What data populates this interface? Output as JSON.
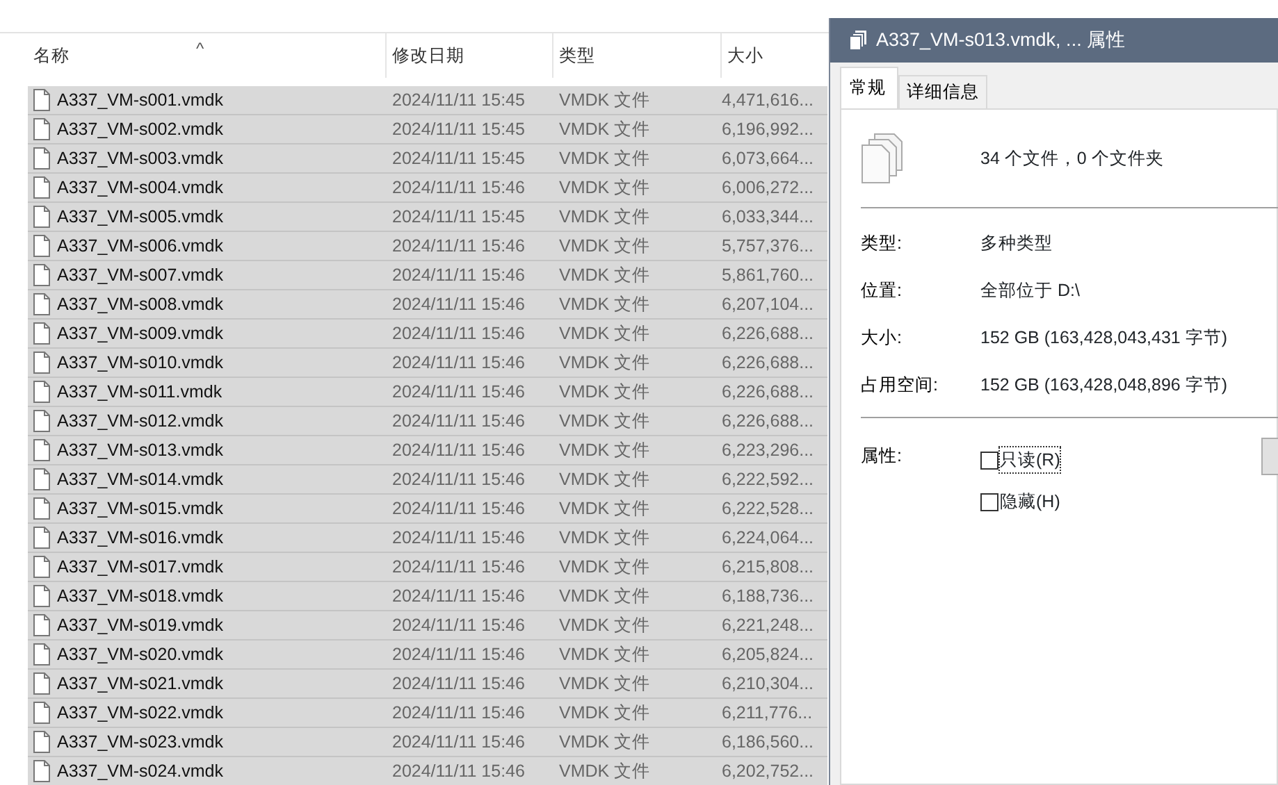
{
  "explorer": {
    "columns": [
      {
        "label": "名称",
        "sorted": true
      },
      {
        "label": "修改日期",
        "sorted": false
      },
      {
        "label": "类型",
        "sorted": false
      },
      {
        "label": "大小",
        "sorted": false
      }
    ],
    "sort_indicator": "^",
    "rows": [
      {
        "name": "A337_VM-s001.vmdk",
        "modified": "2024/11/11 15:45",
        "type": "VMDK 文件",
        "size": "4,471,616...",
        "selected": true
      },
      {
        "name": "A337_VM-s002.vmdk",
        "modified": "2024/11/11 15:45",
        "type": "VMDK 文件",
        "size": "6,196,992...",
        "selected": true
      },
      {
        "name": "A337_VM-s003.vmdk",
        "modified": "2024/11/11 15:45",
        "type": "VMDK 文件",
        "size": "6,073,664...",
        "selected": true
      },
      {
        "name": "A337_VM-s004.vmdk",
        "modified": "2024/11/11 15:46",
        "type": "VMDK 文件",
        "size": "6,006,272...",
        "selected": true
      },
      {
        "name": "A337_VM-s005.vmdk",
        "modified": "2024/11/11 15:45",
        "type": "VMDK 文件",
        "size": "6,033,344...",
        "selected": true
      },
      {
        "name": "A337_VM-s006.vmdk",
        "modified": "2024/11/11 15:46",
        "type": "VMDK 文件",
        "size": "5,757,376...",
        "selected": true
      },
      {
        "name": "A337_VM-s007.vmdk",
        "modified": "2024/11/11 15:46",
        "type": "VMDK 文件",
        "size": "5,861,760...",
        "selected": true
      },
      {
        "name": "A337_VM-s008.vmdk",
        "modified": "2024/11/11 15:46",
        "type": "VMDK 文件",
        "size": "6,207,104...",
        "selected": true
      },
      {
        "name": "A337_VM-s009.vmdk",
        "modified": "2024/11/11 15:46",
        "type": "VMDK 文件",
        "size": "6,226,688...",
        "selected": true
      },
      {
        "name": "A337_VM-s010.vmdk",
        "modified": "2024/11/11 15:46",
        "type": "VMDK 文件",
        "size": "6,226,688...",
        "selected": true
      },
      {
        "name": "A337_VM-s011.vmdk",
        "modified": "2024/11/11 15:46",
        "type": "VMDK 文件",
        "size": "6,226,688...",
        "selected": true
      },
      {
        "name": "A337_VM-s012.vmdk",
        "modified": "2024/11/11 15:46",
        "type": "VMDK 文件",
        "size": "6,226,688...",
        "selected": true
      },
      {
        "name": "A337_VM-s013.vmdk",
        "modified": "2024/11/11 15:46",
        "type": "VMDK 文件",
        "size": "6,223,296...",
        "selected": true
      },
      {
        "name": "A337_VM-s014.vmdk",
        "modified": "2024/11/11 15:46",
        "type": "VMDK 文件",
        "size": "6,222,592...",
        "selected": true
      },
      {
        "name": "A337_VM-s015.vmdk",
        "modified": "2024/11/11 15:46",
        "type": "VMDK 文件",
        "size": "6,222,528...",
        "selected": true
      },
      {
        "name": "A337_VM-s016.vmdk",
        "modified": "2024/11/11 15:46",
        "type": "VMDK 文件",
        "size": "6,224,064...",
        "selected": true
      },
      {
        "name": "A337_VM-s017.vmdk",
        "modified": "2024/11/11 15:46",
        "type": "VMDK 文件",
        "size": "6,215,808...",
        "selected": true
      },
      {
        "name": "A337_VM-s018.vmdk",
        "modified": "2024/11/11 15:46",
        "type": "VMDK 文件",
        "size": "6,188,736...",
        "selected": true
      },
      {
        "name": "A337_VM-s019.vmdk",
        "modified": "2024/11/11 15:46",
        "type": "VMDK 文件",
        "size": "6,221,248...",
        "selected": true
      },
      {
        "name": "A337_VM-s020.vmdk",
        "modified": "2024/11/11 15:46",
        "type": "VMDK 文件",
        "size": "6,205,824...",
        "selected": true
      },
      {
        "name": "A337_VM-s021.vmdk",
        "modified": "2024/11/11 15:46",
        "type": "VMDK 文件",
        "size": "6,210,304...",
        "selected": true
      },
      {
        "name": "A337_VM-s022.vmdk",
        "modified": "2024/11/11 15:46",
        "type": "VMDK 文件",
        "size": "6,211,776...",
        "selected": true
      },
      {
        "name": "A337_VM-s023.vmdk",
        "modified": "2024/11/11 15:46",
        "type": "VMDK 文件",
        "size": "6,186,560...",
        "selected": true
      },
      {
        "name": "A337_VM-s024.vmdk",
        "modified": "2024/11/11 15:46",
        "type": "VMDK 文件",
        "size": "6,202,752...",
        "selected": true
      }
    ]
  },
  "dialog": {
    "title": "A337_VM-s013.vmdk, ... 属性",
    "tabs": [
      {
        "label": "常规",
        "selected": true
      },
      {
        "label": "详细信息",
        "selected": false
      }
    ],
    "summary": "34 个文件，0 个文件夹",
    "properties": [
      {
        "label": "类型:",
        "value": "多种类型"
      },
      {
        "label": "位置:",
        "value": "全部位于 D:\\"
      },
      {
        "label": "大小:",
        "value": "152 GB (163,428,043,431 字节)"
      },
      {
        "label": "占用空间:",
        "value": "152 GB (163,428,048,896 字节)"
      }
    ],
    "attributes_label": "属性:",
    "attributes": [
      {
        "label": "只读(R)",
        "checked": false,
        "focused": true
      },
      {
        "label": "隐藏(H)",
        "checked": false,
        "focused": false
      }
    ]
  }
}
